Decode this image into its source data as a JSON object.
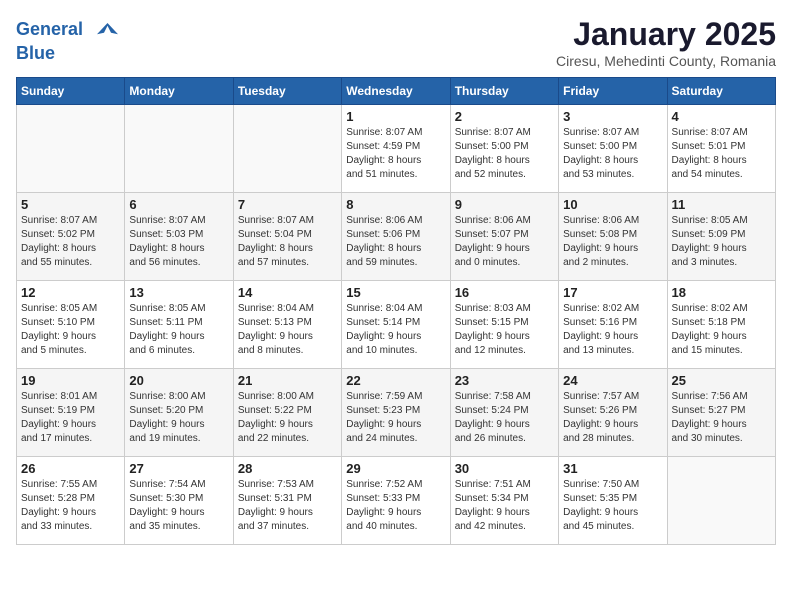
{
  "logo": {
    "line1": "General",
    "line2": "Blue"
  },
  "title": "January 2025",
  "subtitle": "Ciresu, Mehedinti County, Romania",
  "headers": [
    "Sunday",
    "Monday",
    "Tuesday",
    "Wednesday",
    "Thursday",
    "Friday",
    "Saturday"
  ],
  "weeks": [
    [
      {
        "day": "",
        "info": ""
      },
      {
        "day": "",
        "info": ""
      },
      {
        "day": "",
        "info": ""
      },
      {
        "day": "1",
        "info": "Sunrise: 8:07 AM\nSunset: 4:59 PM\nDaylight: 8 hours\nand 51 minutes."
      },
      {
        "day": "2",
        "info": "Sunrise: 8:07 AM\nSunset: 5:00 PM\nDaylight: 8 hours\nand 52 minutes."
      },
      {
        "day": "3",
        "info": "Sunrise: 8:07 AM\nSunset: 5:00 PM\nDaylight: 8 hours\nand 53 minutes."
      },
      {
        "day": "4",
        "info": "Sunrise: 8:07 AM\nSunset: 5:01 PM\nDaylight: 8 hours\nand 54 minutes."
      }
    ],
    [
      {
        "day": "5",
        "info": "Sunrise: 8:07 AM\nSunset: 5:02 PM\nDaylight: 8 hours\nand 55 minutes."
      },
      {
        "day": "6",
        "info": "Sunrise: 8:07 AM\nSunset: 5:03 PM\nDaylight: 8 hours\nand 56 minutes."
      },
      {
        "day": "7",
        "info": "Sunrise: 8:07 AM\nSunset: 5:04 PM\nDaylight: 8 hours\nand 57 minutes."
      },
      {
        "day": "8",
        "info": "Sunrise: 8:06 AM\nSunset: 5:06 PM\nDaylight: 8 hours\nand 59 minutes."
      },
      {
        "day": "9",
        "info": "Sunrise: 8:06 AM\nSunset: 5:07 PM\nDaylight: 9 hours\nand 0 minutes."
      },
      {
        "day": "10",
        "info": "Sunrise: 8:06 AM\nSunset: 5:08 PM\nDaylight: 9 hours\nand 2 minutes."
      },
      {
        "day": "11",
        "info": "Sunrise: 8:05 AM\nSunset: 5:09 PM\nDaylight: 9 hours\nand 3 minutes."
      }
    ],
    [
      {
        "day": "12",
        "info": "Sunrise: 8:05 AM\nSunset: 5:10 PM\nDaylight: 9 hours\nand 5 minutes."
      },
      {
        "day": "13",
        "info": "Sunrise: 8:05 AM\nSunset: 5:11 PM\nDaylight: 9 hours\nand 6 minutes."
      },
      {
        "day": "14",
        "info": "Sunrise: 8:04 AM\nSunset: 5:13 PM\nDaylight: 9 hours\nand 8 minutes."
      },
      {
        "day": "15",
        "info": "Sunrise: 8:04 AM\nSunset: 5:14 PM\nDaylight: 9 hours\nand 10 minutes."
      },
      {
        "day": "16",
        "info": "Sunrise: 8:03 AM\nSunset: 5:15 PM\nDaylight: 9 hours\nand 12 minutes."
      },
      {
        "day": "17",
        "info": "Sunrise: 8:02 AM\nSunset: 5:16 PM\nDaylight: 9 hours\nand 13 minutes."
      },
      {
        "day": "18",
        "info": "Sunrise: 8:02 AM\nSunset: 5:18 PM\nDaylight: 9 hours\nand 15 minutes."
      }
    ],
    [
      {
        "day": "19",
        "info": "Sunrise: 8:01 AM\nSunset: 5:19 PM\nDaylight: 9 hours\nand 17 minutes."
      },
      {
        "day": "20",
        "info": "Sunrise: 8:00 AM\nSunset: 5:20 PM\nDaylight: 9 hours\nand 19 minutes."
      },
      {
        "day": "21",
        "info": "Sunrise: 8:00 AM\nSunset: 5:22 PM\nDaylight: 9 hours\nand 22 minutes."
      },
      {
        "day": "22",
        "info": "Sunrise: 7:59 AM\nSunset: 5:23 PM\nDaylight: 9 hours\nand 24 minutes."
      },
      {
        "day": "23",
        "info": "Sunrise: 7:58 AM\nSunset: 5:24 PM\nDaylight: 9 hours\nand 26 minutes."
      },
      {
        "day": "24",
        "info": "Sunrise: 7:57 AM\nSunset: 5:26 PM\nDaylight: 9 hours\nand 28 minutes."
      },
      {
        "day": "25",
        "info": "Sunrise: 7:56 AM\nSunset: 5:27 PM\nDaylight: 9 hours\nand 30 minutes."
      }
    ],
    [
      {
        "day": "26",
        "info": "Sunrise: 7:55 AM\nSunset: 5:28 PM\nDaylight: 9 hours\nand 33 minutes."
      },
      {
        "day": "27",
        "info": "Sunrise: 7:54 AM\nSunset: 5:30 PM\nDaylight: 9 hours\nand 35 minutes."
      },
      {
        "day": "28",
        "info": "Sunrise: 7:53 AM\nSunset: 5:31 PM\nDaylight: 9 hours\nand 37 minutes."
      },
      {
        "day": "29",
        "info": "Sunrise: 7:52 AM\nSunset: 5:33 PM\nDaylight: 9 hours\nand 40 minutes."
      },
      {
        "day": "30",
        "info": "Sunrise: 7:51 AM\nSunset: 5:34 PM\nDaylight: 9 hours\nand 42 minutes."
      },
      {
        "day": "31",
        "info": "Sunrise: 7:50 AM\nSunset: 5:35 PM\nDaylight: 9 hours\nand 45 minutes."
      },
      {
        "day": "",
        "info": ""
      }
    ]
  ]
}
